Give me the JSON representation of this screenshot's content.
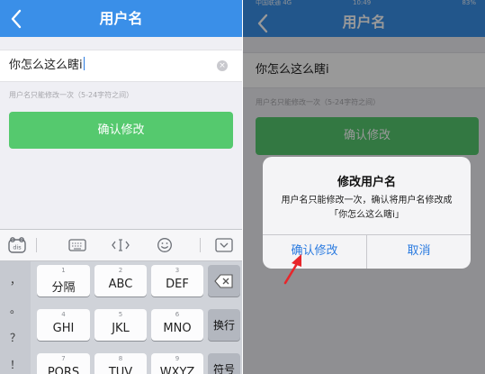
{
  "left": {
    "title": "用户名",
    "input_value": "你怎么这么瞎i",
    "clear_icon": "×",
    "hint": "用户名只能修改一次（5-24字符之间）",
    "confirm_label": "确认修改",
    "keyboard": {
      "toolbar": {
        "logo": "dis",
        "keyboard_icon": "keyboard-icon",
        "cursor_icon": "cursor-move-icon",
        "emoji_icon": "emoji-icon",
        "collapse_icon": "collapse-keyboard-icon"
      },
      "symbols": [
        "，",
        "。",
        "？",
        "！"
      ],
      "keys": [
        {
          "num": "1",
          "label": "分隔"
        },
        {
          "num": "2",
          "label": "ABC"
        },
        {
          "num": "3",
          "label": "DEF"
        },
        {
          "num": "4",
          "label": "GHI"
        },
        {
          "num": "5",
          "label": "JKL"
        },
        {
          "num": "6",
          "label": "MNO"
        },
        {
          "num": "7",
          "label": "PQRS"
        },
        {
          "num": "8",
          "label": "TUV"
        },
        {
          "num": "9",
          "label": "WXYZ"
        }
      ],
      "delete_icon": "×",
      "enter_label": "换行",
      "symbol_label": "符号"
    }
  },
  "right": {
    "status": {
      "carrier": "中国联通  4G",
      "time": "10:49",
      "battery": "83%"
    },
    "title": "用户名",
    "input_value": "你怎么这么瞎i",
    "hint": "用户名只能修改一次（5-24字符之间）",
    "confirm_label": "确认修改",
    "dialog": {
      "title": "修改用户名",
      "message": "用户名只能修改一次，确认将用户名修改成「你怎么这么瞎i」",
      "ok_label": "确认修改",
      "cancel_label": "取消"
    }
  },
  "colors": {
    "nav_blue": "#3a8fe8",
    "button_green": "#55c96e",
    "link_blue": "#2b7be0",
    "arrow_red": "#e8262b"
  }
}
